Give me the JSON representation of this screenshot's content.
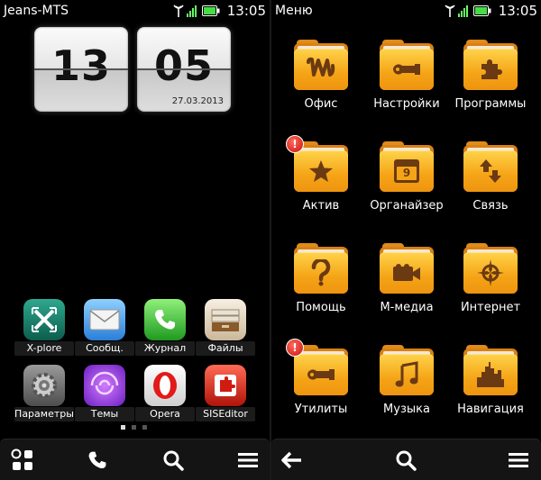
{
  "left": {
    "status": {
      "operator": "Jeans-MTS",
      "time": "13:05"
    },
    "clock": {
      "hour": "13",
      "minute": "05",
      "date": "27.03.2013"
    },
    "apps": [
      {
        "label": "X-plore",
        "icon": "xplore-icon"
      },
      {
        "label": "Сообщ.",
        "icon": "messages-icon"
      },
      {
        "label": "Журнал",
        "icon": "phone-log-icon"
      },
      {
        "label": "Файлы",
        "icon": "files-icon"
      },
      {
        "label": "Параметры",
        "icon": "settings-gear-icon"
      },
      {
        "label": "Темы",
        "icon": "themes-icon"
      },
      {
        "label": "Opera",
        "icon": "opera-icon"
      },
      {
        "label": "SISEditor",
        "icon": "siseditor-icon"
      }
    ],
    "page_indicator": {
      "pages": 3,
      "current": 1
    },
    "bottom_bar": [
      "apps-grid-icon",
      "phone-icon",
      "search-icon",
      "menu-icon"
    ]
  },
  "right": {
    "status": {
      "title": "Меню",
      "time": "13:05"
    },
    "folders": [
      {
        "label": "Офис",
        "icon": "office-icon",
        "badge": ""
      },
      {
        "label": "Настройки",
        "icon": "wrench-icon",
        "badge": ""
      },
      {
        "label": "Программы",
        "icon": "puzzle-icon",
        "badge": ""
      },
      {
        "label": "Актив",
        "icon": "star-icon",
        "badge": "!"
      },
      {
        "label": "Органайзер",
        "icon": "calendar-icon",
        "badge": "",
        "calendar_day": "9"
      },
      {
        "label": "Связь",
        "icon": "transfer-arrows-icon",
        "badge": ""
      },
      {
        "label": "Помощь",
        "icon": "question-icon",
        "badge": ""
      },
      {
        "label": "М-медиа",
        "icon": "camera-icon",
        "badge": ""
      },
      {
        "label": "Интернет",
        "icon": "globe-compass-icon",
        "badge": ""
      },
      {
        "label": "Утилиты",
        "icon": "wrench-icon",
        "badge": "!"
      },
      {
        "label": "Музыка",
        "icon": "music-note-icon",
        "badge": ""
      },
      {
        "label": "Навигация",
        "icon": "city-icon",
        "badge": ""
      }
    ],
    "bottom_bar": [
      "back-arrow-icon",
      "search-icon",
      "menu-icon"
    ]
  },
  "colors": {
    "folder": "#f5a416",
    "badge": "#d51a10",
    "status_bar": "#000000"
  }
}
